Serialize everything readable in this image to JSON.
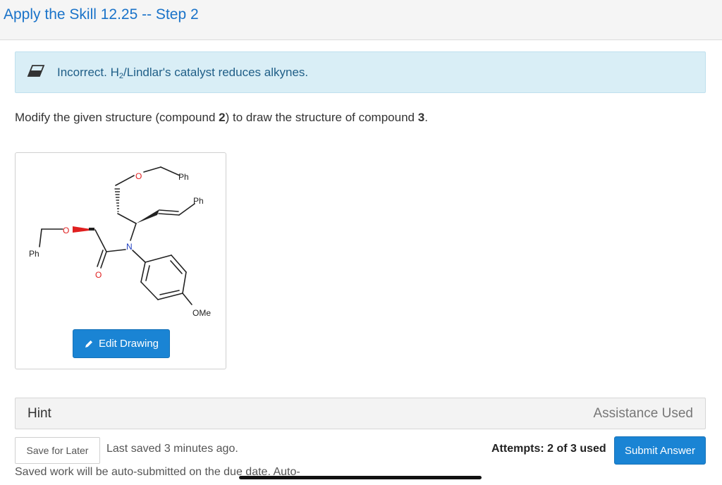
{
  "header": {
    "title": "Apply the Skill 12.25 -- Step 2"
  },
  "alert": {
    "icon": "eraser-icon",
    "text_before": "Incorrect. H",
    "subscript": "2",
    "text_after": "/Lindlar's catalyst reduces alkynes."
  },
  "instruction": {
    "part1": "Modify the given structure (compound ",
    "bold1": "2",
    "part2": ") to draw the structure of compound ",
    "bold2": "3",
    "part3": "."
  },
  "molecule": {
    "labels": {
      "ph_top": "Ph",
      "ph_mid": "Ph",
      "ph_left": "Ph",
      "oxygen_top": "O",
      "oxygen_left": "O",
      "nitrogen": "N",
      "carbonyl_oxygen": "O",
      "ome": "OMe"
    }
  },
  "edit_button": {
    "label": "Edit Drawing",
    "icon": "pencil-icon"
  },
  "hint": {
    "label": "Hint",
    "assistance": "Assistance Used"
  },
  "footer": {
    "save_label": "Save for Later",
    "last_saved": "Last saved 3 minutes ago.",
    "attempts": "Attempts: 2 of 3 used",
    "submit_label": "Submit Answer",
    "autosubmit": "Saved work will be auto-submitted on the due date. Auto-"
  },
  "colors": {
    "title_blue": "#1a73c9",
    "alert_bg": "#d9eef6",
    "alert_text": "#1f5e87",
    "button_blue": "#1a84d4",
    "oxygen_red": "#e02020"
  }
}
